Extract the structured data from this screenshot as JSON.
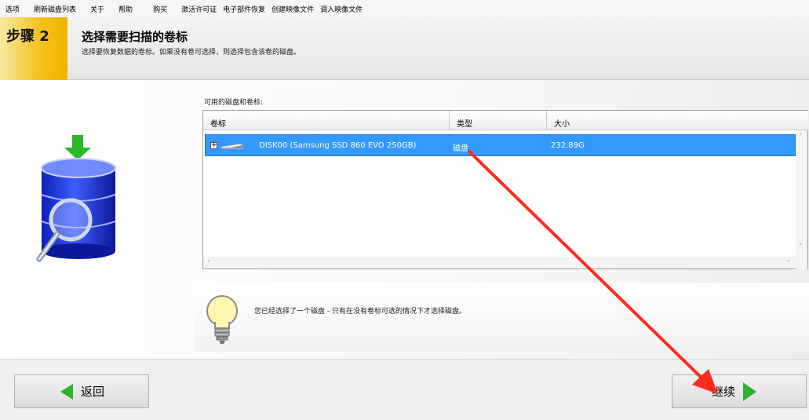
{
  "menu": [
    "选项",
    "刷新磁盘列表",
    "关于",
    "帮助",
    "购买",
    "激活许可证",
    "电子部件恢复",
    "创建映像文件",
    "调入映像文件"
  ],
  "header": {
    "step": "步骤 2",
    "title": "选择需要扫描的卷标",
    "subtitle": "选择要恢复数据的卷标。如果没有卷可选择，则选择包含该卷的磁盘。"
  },
  "volumes": {
    "caption": "可用的磁盘和卷标:",
    "columns": [
      "卷标",
      "类型",
      "大小"
    ],
    "rows": [
      {
        "name": "DISK00 (Samsung SSD 860 EVO 250GB)",
        "type": "磁盘",
        "size": "232.89G",
        "selected": true
      }
    ]
  },
  "hint": "您已经选择了一个磁盘 - 只有在没有卷标可选的情况下才选择磁盘。",
  "buttons": {
    "back": "返回",
    "next": "继续"
  },
  "colors": {
    "selection": "#3399ff",
    "step_badge": "#f2c21b",
    "nav_arrow": "#30b030",
    "annotation_arrow": "#ff2a1f"
  }
}
